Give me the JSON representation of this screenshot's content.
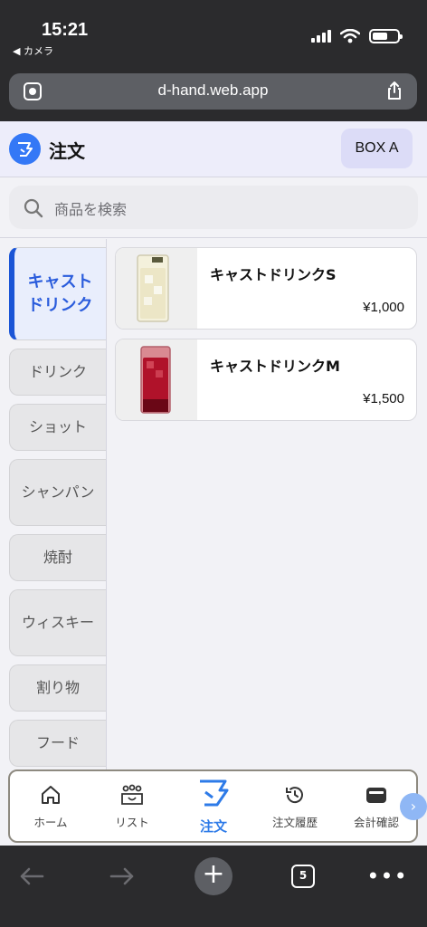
{
  "status": {
    "time": "15:21",
    "back_label": "◀ カメラ"
  },
  "browser": {
    "url": "d-hand.web.app",
    "tab_count": "5"
  },
  "header": {
    "title": "注文",
    "box_button": "BOX A"
  },
  "search": {
    "placeholder": "商品を検索"
  },
  "categories": [
    {
      "label": "キャストドリンク",
      "active": true
    },
    {
      "label": "ドリンク",
      "active": false
    },
    {
      "label": "ショット",
      "active": false
    },
    {
      "label": "シャンパン",
      "active": false
    },
    {
      "label": "焼酎",
      "active": false
    },
    {
      "label": "ウィスキー",
      "active": false
    },
    {
      "label": "割り物",
      "active": false
    },
    {
      "label": "フード",
      "active": false
    }
  ],
  "products": [
    {
      "name": "キャストドリンクS",
      "price": "¥1,000",
      "drink_color": "#ece6c6"
    },
    {
      "name": "キャストドリンクM",
      "price": "¥1,500",
      "drink_color": "#b0122a"
    }
  ],
  "bottom_nav": [
    {
      "label": "ホーム",
      "icon": "home-icon"
    },
    {
      "label": "リスト",
      "icon": "list-icon"
    },
    {
      "label": "注文",
      "icon": "order-icon",
      "active": true
    },
    {
      "label": "注文履歴",
      "icon": "history-icon"
    },
    {
      "label": "会計確認",
      "icon": "wallet-icon"
    }
  ],
  "colors": {
    "accent": "#2e7be8",
    "active_category": "#1b55d6"
  }
}
